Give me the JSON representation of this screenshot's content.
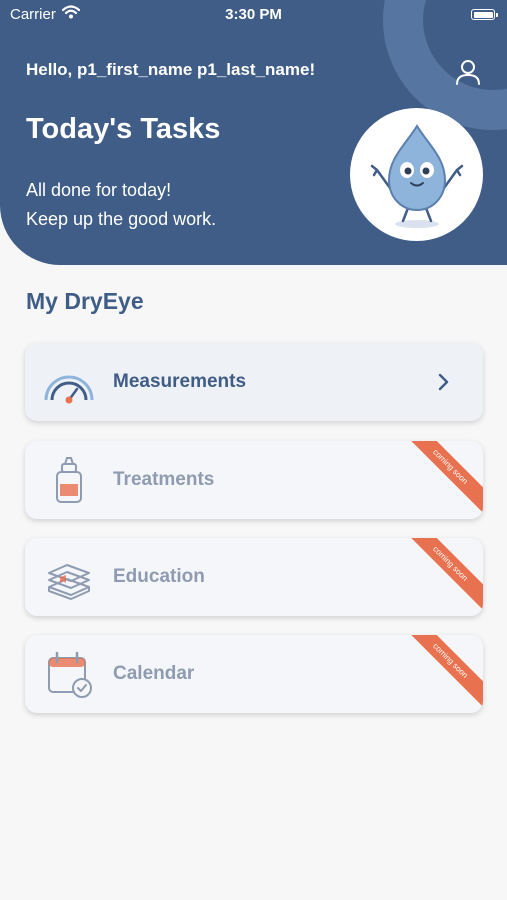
{
  "status_bar": {
    "carrier": "Carrier",
    "time": "3:30 PM"
  },
  "header": {
    "greeting": "Hello, p1_first_name p1_last_name!",
    "title": "Today's Tasks",
    "message_line1": "All done for today!",
    "message_line2": "Keep up the good work."
  },
  "section": {
    "title": "My DryEye"
  },
  "cards": [
    {
      "label": "Measurements",
      "icon": "gauge-icon",
      "enabled": true
    },
    {
      "label": "Treatments",
      "icon": "eye-drop-bottle-icon",
      "ribbon": "coming soon",
      "enabled": false
    },
    {
      "label": "Education",
      "icon": "books-icon",
      "ribbon": "coming soon",
      "enabled": false
    },
    {
      "label": "Calendar",
      "icon": "calendar-check-icon",
      "ribbon": "coming soon",
      "enabled": false
    }
  ],
  "colors": {
    "primary": "#3f5d86",
    "accent": "#e8714f",
    "muted_text": "#8e9bb0",
    "background": "#f7f7f8"
  }
}
